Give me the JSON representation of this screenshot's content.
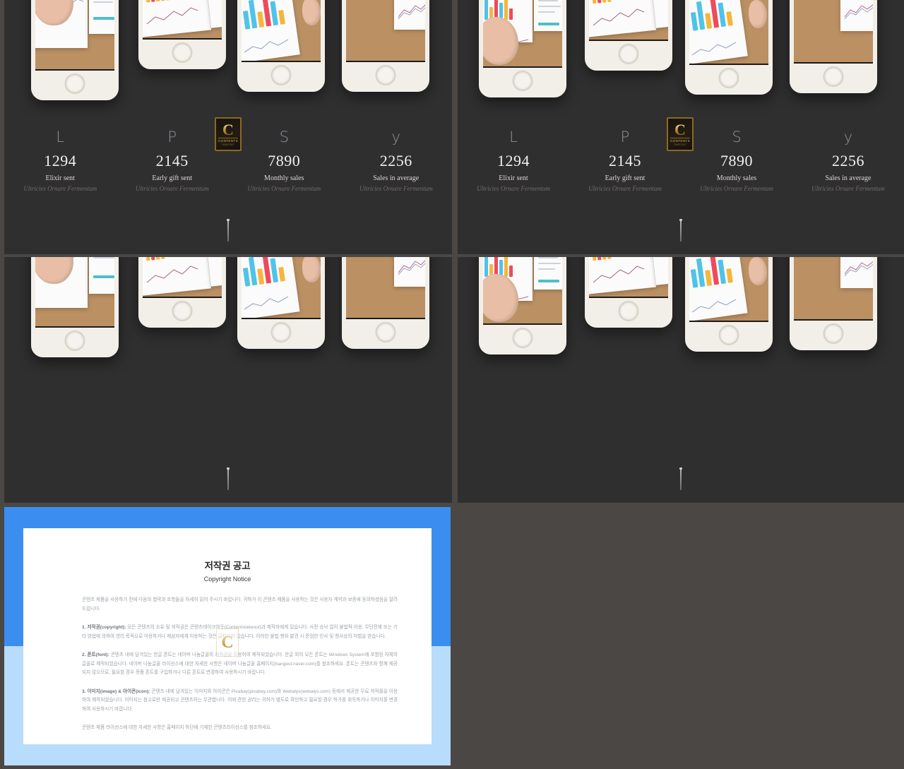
{
  "theme": {
    "page_background": "#4a4745",
    "panel_background": "#302f30",
    "accent_blue": "#3b8ef0",
    "accent_blue_light": "#b8dcfb",
    "gold": "#c69a34",
    "number_color": "#f3f1ee",
    "glyph_color": "#8d949c"
  },
  "logo": {
    "letter": "C",
    "line1": "CONTENTS",
    "line2": "TAKEOUT"
  },
  "stats": [
    {
      "glyph": "L",
      "icon_name": "letter-l-icon",
      "number": "1294",
      "caption": "Elixir sent",
      "subcaption": "Ultricies Ornare Fermentum"
    },
    {
      "glyph": "P",
      "icon_name": "letter-p-icon",
      "number": "2145",
      "caption": "Early gift sent",
      "subcaption": "Ultricies Ornare Fermentum"
    },
    {
      "glyph": "S",
      "icon_name": "letter-s-icon",
      "number": "7890",
      "caption": "Monthly sales",
      "subcaption": "Ultricies Ornare Fermentum"
    },
    {
      "glyph": "y",
      "icon_name": "letter-y-icon",
      "number": "2256",
      "caption": "Sales in average",
      "subcaption": "Ultricies Ornare Fermentum"
    }
  ],
  "slides": [
    {
      "id": "slide-top-left",
      "position": "top-left"
    },
    {
      "id": "slide-top-right",
      "position": "top-right"
    },
    {
      "id": "slide-bottom-left",
      "position": "bottom-left"
    },
    {
      "id": "slide-bottom-right",
      "position": "bottom-right"
    }
  ],
  "document": {
    "title_ko": "저작권 공고",
    "title_en": "Copyright Notice",
    "intro": "콘텐츠 제품을 사용하기 전에 다음의 협약과 조항들을 자세히 읽어 주시기 바랍니다. 귀하가 이 콘텐츠 제품을 사용하는 것은 사용자 계약과 보증에 동의하셨음을 알려드립니다.",
    "clause1_label": "1. 저작권(copyright):",
    "clause1": "모든 콘텐츠의 소유 및 저작권은 콘텐츠테이크아웃(Contentstakeout)과 제작자에게 있습니다. 사전 승낙 없이 불법적 이용, 무단전재 또는 기타 방법에 의하여 영리 목적으로 이용하거나 제삼자에게 이용하는 것은 금지되어 있습니다. 이러한 불법 행위 발견 시 준엄한 민사 및 형사상의 처벌을 받습니다.",
    "clause2_label": "2. 폰트(font):",
    "clause2": "콘텐츠 내에 담겨있는 한글 폰트는 네이버 나눔글꼴의 저작권을 이용하여 제작되었습니다. 한글 외의 모든 폰트는 Windows System에 포함된 자체의 글꼴로 제작되었습니다. 네이버 나눔글꼴 라이선스에 대한 자세한 사항은 네이버 나눔글꼴 홈페이지(hangeul.naver.com)를 참조하세요. 폰트는 콘텐츠와 함께 제공되지 않으므로, 필요할 경우 정품 폰트를 구입하거나 다른 폰트로 변경하여 사용하시기 바랍니다.",
    "clause3_label": "3. 이미지(image) & 아이콘(icon):",
    "clause3": "콘텐츠 내에 담겨있는 이미지와 아이콘은 Pixabay(pixabay.com)와 Webalys(webalys.com) 등에서 제공한 무료 저작물을 이용하여 제작되었습니다. 이미지는 참고로만 제공되고 콘텐츠와는 무관합니다. 이에 관한 권리는 귀하가 별도로 확인하고 필요할 경우 허가를 취득하거나 이미지를 변경하여 사용하시기 바랍니다.",
    "footer": "콘텐츠 제품 라이선스에 대한 자세한 사항은 홈페이지 하단에 기재한 콘텐츠라이선스를 참조하세요."
  }
}
